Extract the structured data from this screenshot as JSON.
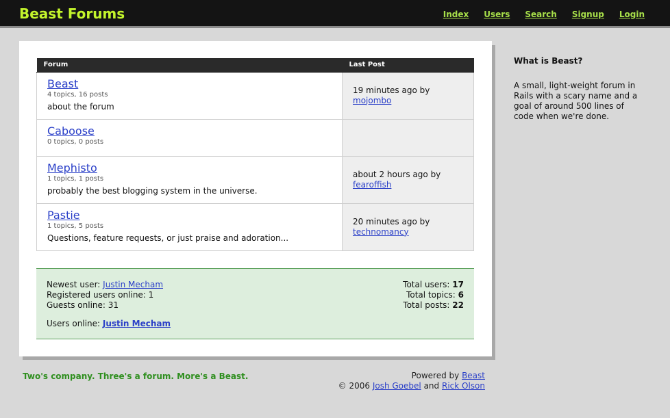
{
  "header": {
    "title": "Beast Forums",
    "nav": [
      "Index",
      "Users",
      "Search",
      "Signup",
      "Login"
    ]
  },
  "table": {
    "headers": [
      "Forum",
      "Last Post"
    ],
    "rows": [
      {
        "name": "Beast",
        "counts": "4 topics, 16 posts",
        "description": "about the forum",
        "last_post": "19 minutes ago by",
        "last_user": "mojombo"
      },
      {
        "name": "Caboose",
        "counts": "0 topics, 0 posts",
        "description": "",
        "last_post": "",
        "last_user": ""
      },
      {
        "name": "Mephisto",
        "counts": "1 topics, 1 posts",
        "description": "probably the best blogging system in the universe.",
        "last_post": "about 2 hours ago by",
        "last_user": "fearoffish"
      },
      {
        "name": "Pastie",
        "counts": "1 topics, 5 posts",
        "description": "Questions, feature requests, or just praise and adoration...",
        "last_post": "20 minutes ago by",
        "last_user": "technomancy"
      }
    ]
  },
  "stats": {
    "newest_label": "Newest user:",
    "newest_user": "Justin Mecham",
    "registered_label": "Registered users online:",
    "registered_value": "1",
    "guests_label": "Guests online:",
    "guests_value": "31",
    "online_label": "Users online:",
    "online_user": "Justin Mecham",
    "total_users_label": "Total users:",
    "total_users": "17",
    "total_topics_label": "Total topics:",
    "total_topics": "6",
    "total_posts_label": "Total posts:",
    "total_posts": "22"
  },
  "sidebar": {
    "title": "What is Beast?",
    "text": "A small, light-weight forum in Rails with a scary name and a goal of around 500 lines of code when we're done."
  },
  "footer": {
    "tagline": "Two's company. Three's a forum. More's a Beast.",
    "powered_label": "Powered by",
    "powered_link": "Beast",
    "copyright": "© 2006",
    "author1": "Josh Goebel",
    "and": "and",
    "author2": "Rick Olson"
  },
  "colors": {
    "header_bg": "#141414",
    "title": "#c4f52c",
    "nav_link": "#a8e04a",
    "stats_bg": "#ddeedd",
    "tagline": "#2f8f1f",
    "link": "#2a3fc8"
  }
}
